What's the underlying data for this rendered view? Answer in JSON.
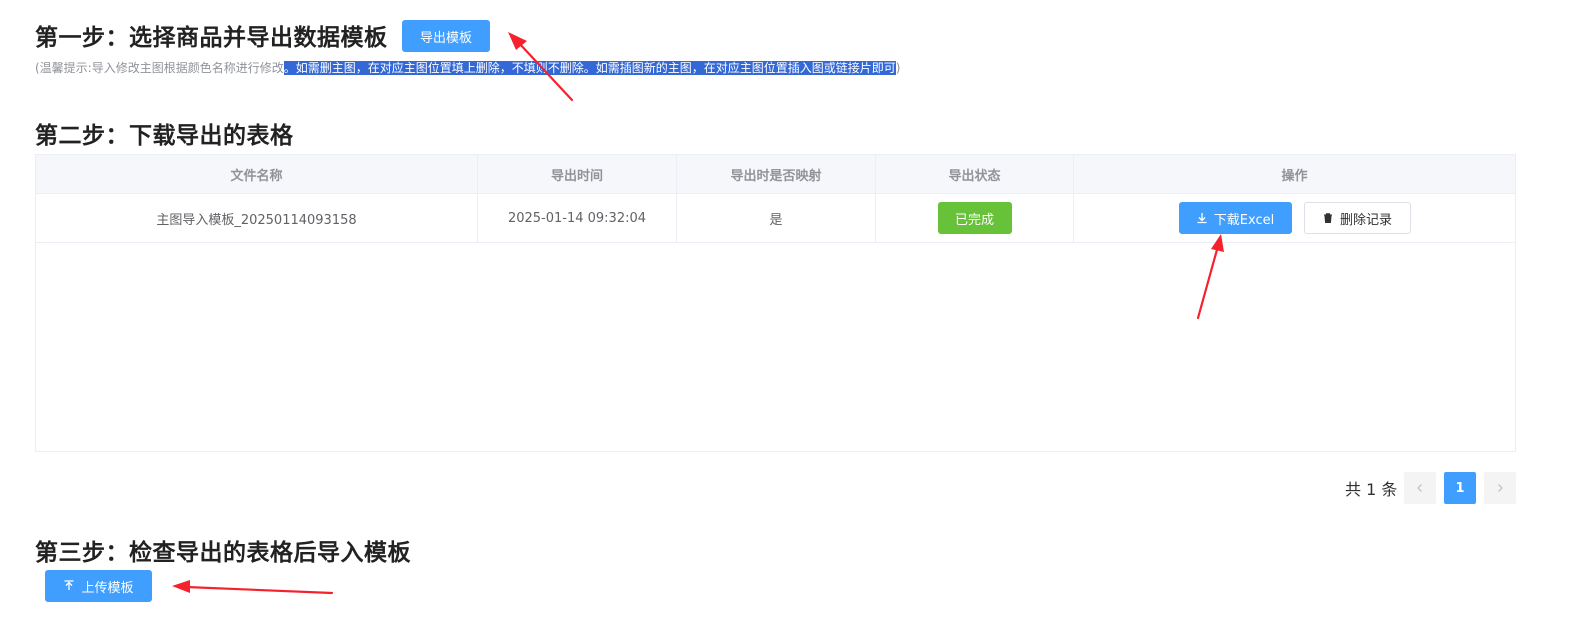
{
  "step1": {
    "title": "第一步：选择商品并导出数据模板",
    "export_button": "导出模板",
    "hint_plain": "(温馨提示:导入修改主图根据颜色名称进行修改",
    "hint_selected": "。如需删主图，在对应主图位置填上删除，不填则不删除。如需插图新的主图，在对应主图位置插入图或链接片即可",
    "hint_end": ")"
  },
  "step2": {
    "title": "第二步：下载导出的表格",
    "table": {
      "headers": [
        "文件名称",
        "导出时间",
        "导出时是否映射",
        "导出状态",
        "操作"
      ],
      "rows": [
        {
          "file_name": "主图导入模板_20250114093158",
          "export_time": "2025-01-14 09:32:04",
          "mapped": "是",
          "status": "已完成",
          "download_label": "下载Excel",
          "delete_label": "删除记录"
        }
      ]
    },
    "pagination": {
      "total_text": "共 1 条",
      "current_page": "1",
      "prev_icon": "chevron-left-icon",
      "next_icon": "chevron-right-icon"
    }
  },
  "step3": {
    "title": "第三步：检查导出的表格后导入模板",
    "upload_button": "上传模板"
  },
  "colors": {
    "primary": "#409eff",
    "success": "#67c23a",
    "annotation_arrow": "#f5222d",
    "selection": "#3368d6"
  }
}
